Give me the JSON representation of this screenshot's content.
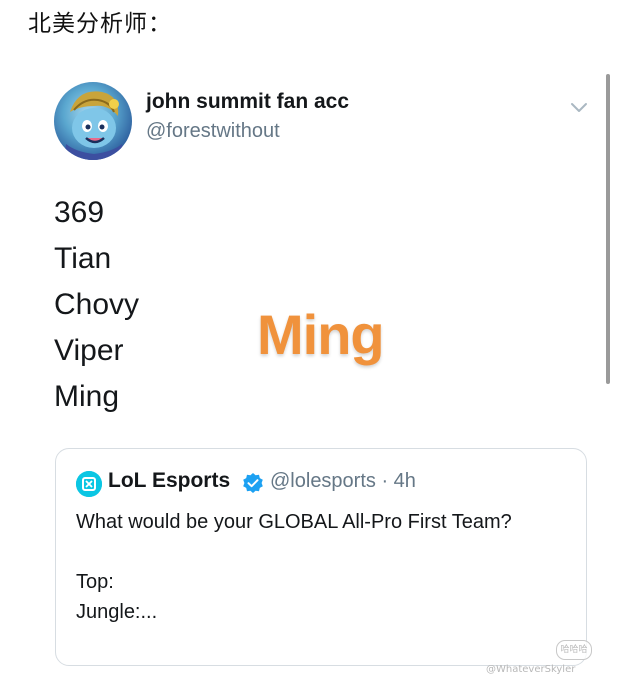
{
  "post": {
    "caption": "北美分析师："
  },
  "tweet": {
    "author_name": "john summit fan acc",
    "author_handle": "@forestwithout",
    "avatar_icon": "league-champion-avatar",
    "menu_icon": "chevron-down-icon",
    "lines": [
      "369",
      "Tian",
      "Chovy",
      "Viper",
      "Ming"
    ]
  },
  "overlay": {
    "text": "Ming",
    "color": "#f0923c"
  },
  "quoted_tweet": {
    "author_name": "LoL Esports",
    "verified_icon": "verified-badge-icon",
    "handle_and_time": "@lolesports · 4h",
    "body_line_1": "What would be your GLOBAL All-Pro First Team?",
    "body_line_2": "Top:",
    "body_line_3": "Jungle:...",
    "logo_icon": "lol-esports-logo-icon",
    "logo_color": "#0bc6e3",
    "verified_color": "#1da1f2"
  },
  "watermark": {
    "badge_text": "哈哈哈",
    "text": "@WhateverSkyler"
  },
  "colors": {
    "secondary_text": "#657786",
    "primary_text": "#14171a",
    "border": "#d7dde2"
  }
}
